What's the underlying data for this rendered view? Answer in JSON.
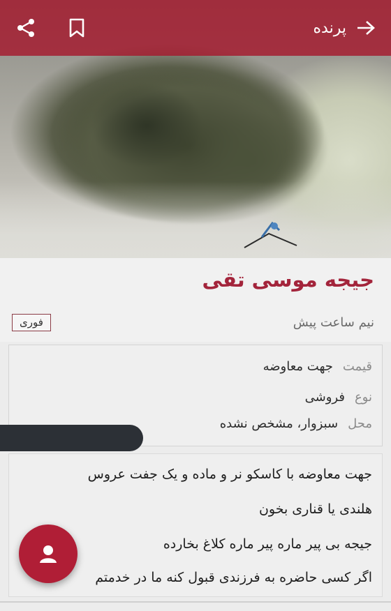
{
  "topbar": {
    "title": "پرنده",
    "back_icon": "arrow-right-icon",
    "bookmark_icon": "bookmark-icon",
    "share_icon": "share-icon",
    "color": "#a5192d"
  },
  "ad": {
    "title": "جیجه موسی تقی",
    "time": "نیم ساعت پیش",
    "badge": "فوری"
  },
  "details": [
    {
      "key": "قیمت",
      "value": "جهت معاوضه"
    },
    {
      "key": "نوع",
      "value": "فروشی"
    },
    {
      "key": "محل",
      "value": "سبزوار، مشخص نشده"
    }
  ],
  "description": [
    "جهت معاوضه با کاسکو نر و ماده و یک جفت عروس",
    "هلندی یا قناری بخون",
    "جیجه بی پیر ماره پیر ماره کلاغ بخارده",
    "اگر کسی حاضره به فرزندی قبول کنه ما در خدمتم"
  ],
  "fab": {
    "icon": "contact-person-icon",
    "color": "#b01e36"
  }
}
